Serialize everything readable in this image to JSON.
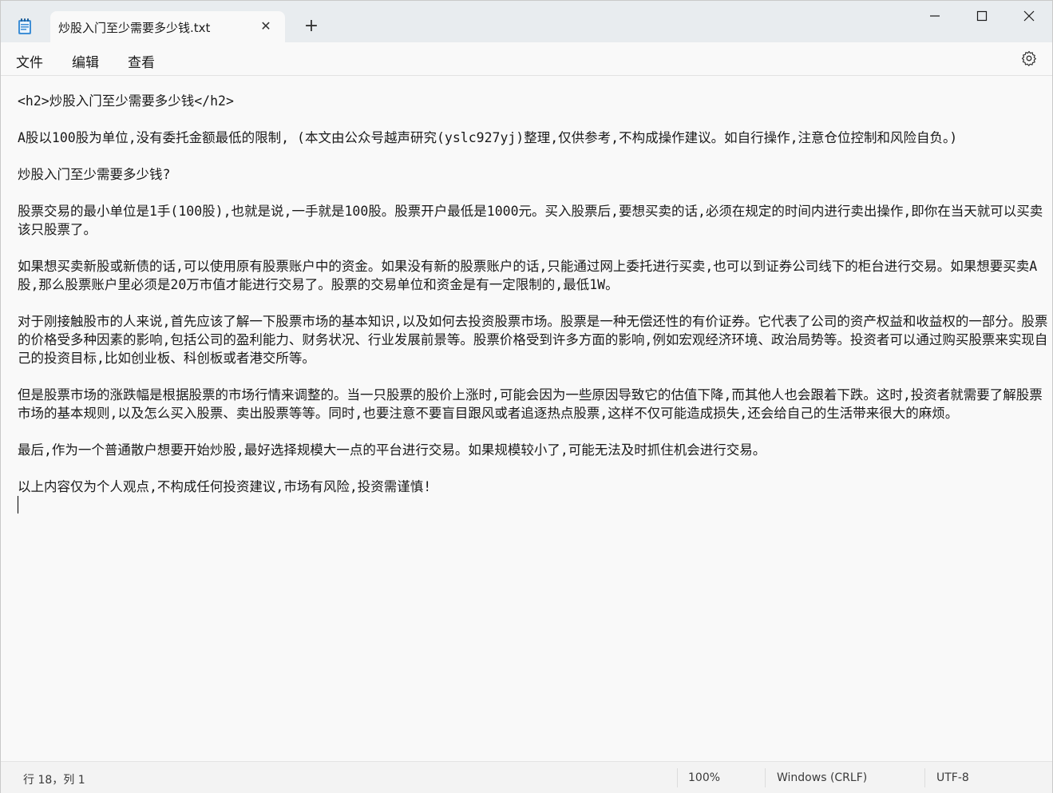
{
  "window": {
    "tab_title": "炒股入门至少需要多少钱.txt",
    "new_tab_symbol": "+",
    "close_tab_symbol": "✕"
  },
  "menu": {
    "file": "文件",
    "edit": "编辑",
    "view": "查看"
  },
  "document": {
    "lines": [
      "<h2>炒股入门至少需要多少钱</h2>",
      "",
      "A股以100股为单位,没有委托金额最低的限制, (本文由公众号越声研究(yslc927yj)整理,仅供参考,不构成操作建议。如自行操作,注意仓位控制和风险自负。)",
      "",
      "炒股入门至少需要多少钱?",
      "",
      "股票交易的最小单位是1手(100股),也就是说,一手就是100股。股票开户最低是1000元。买入股票后,要想买卖的话,必须在规定的时间内进行卖出操作,即你在当天就可以买卖该只股票了。",
      "",
      "如果想买卖新股或新债的话,可以使用原有股票账户中的资金。如果没有新的股票账户的话,只能通过网上委托进行买卖,也可以到证券公司线下的柜台进行交易。如果想要买卖A股,那么股票账户里必须是20万市值才能进行交易了。股票的交易单位和资金是有一定限制的,最低1W。",
      "",
      "对于刚接触股市的人来说,首先应该了解一下股票市场的基本知识,以及如何去投资股票市场。股票是一种无偿还性的有价证券。它代表了公司的资产权益和收益权的一部分。股票的价格受多种因素的影响,包括公司的盈利能力、财务状况、行业发展前景等。股票价格受到许多方面的影响,例如宏观经济环境、政治局势等。投资者可以通过购买股票来实现自己的投资目标,比如创业板、科创板或者港交所等。",
      "",
      "但是股票市场的涨跌幅是根据股票的市场行情来调整的。当一只股票的股价上涨时,可能会因为一些原因导致它的估值下降,而其他人也会跟着下跌。这时,投资者就需要了解股票市场的基本规则,以及怎么买入股票、卖出股票等等。同时,也要注意不要盲目跟风或者追逐热点股票,这样不仅可能造成损失,还会给自己的生活带来很大的麻烦。",
      "",
      "最后,作为一个普通散户想要开始炒股,最好选择规模大一点的平台进行交易。如果规模较小了,可能无法及时抓住机会进行交易。",
      "",
      "以上内容仅为个人观点,不构成任何投资建议,市场有风险,投资需谨慎!"
    ]
  },
  "status": {
    "position": "行 18，列 1",
    "zoom": "100%",
    "line_ending": "Windows (CRLF)",
    "encoding": "UTF-8"
  }
}
